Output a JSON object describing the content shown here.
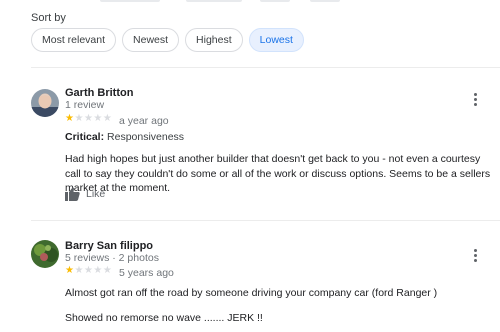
{
  "sort": {
    "label": "Sort by",
    "options": [
      "Most relevant",
      "Newest",
      "Highest",
      "Lowest"
    ],
    "selected": "Lowest"
  },
  "reviews": [
    {
      "author": "Garth Britton",
      "meta": "1 review",
      "rating": 1,
      "max_rating": 5,
      "time": "a year ago",
      "critical_label": "Critical:",
      "critical_value": "Responsiveness",
      "text": "Had high hopes but just another builder that doesn't get back to you - not even a courtesy call to say they couldn't do some or all of the work or discuss options. Seems to be a sellers market at the moment.",
      "like_label": "Like"
    },
    {
      "author": "Barry San filippo",
      "meta": "5 reviews · 2 photos",
      "rating": 1,
      "max_rating": 5,
      "time": "5 years ago",
      "text_line1": "Almost got ran off the road by someone driving your company car (ford Ranger )",
      "text_line2": "Showed no remorse no wave ....... JERK !!"
    }
  ],
  "colors": {
    "accent": "#1a73e8",
    "star": "#fbbc04"
  },
  "icons": [
    "thumbs-up-icon",
    "more-vert-icon"
  ]
}
